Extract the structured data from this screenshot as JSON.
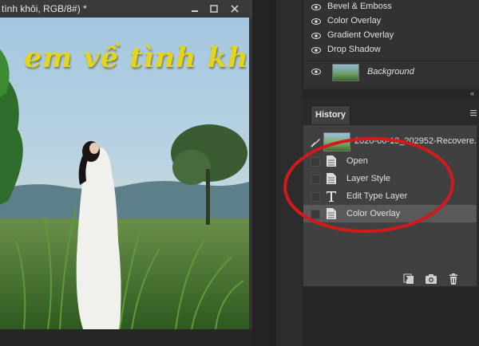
{
  "document": {
    "title": "tình khôi, RGB/8#) *",
    "canvas_text": "em về tình khôi"
  },
  "layers": {
    "effects": [
      {
        "label": "Bevel & Emboss"
      },
      {
        "label": "Color Overlay"
      },
      {
        "label": "Gradient Overlay"
      },
      {
        "label": "Drop Shadow"
      }
    ],
    "background_label": "Background"
  },
  "history": {
    "tab_label": "History",
    "collapse_label": "«",
    "snapshot_label": "2020-06-18_202952-Recovere...",
    "states": [
      {
        "label": "Open",
        "icon": "document-icon",
        "selected": false
      },
      {
        "label": "Layer Style",
        "icon": "document-icon",
        "selected": false
      },
      {
        "label": "Edit Type Layer",
        "icon": "type-tool-icon",
        "selected": false
      },
      {
        "label": "Color Overlay",
        "icon": "document-icon",
        "selected": true
      }
    ],
    "footer_icons": [
      "new-document-from-state-icon",
      "camera-snapshot-icon",
      "trash-icon"
    ]
  },
  "colors": {
    "text_fill": "#e4d51a",
    "annotation": "#d11a1a",
    "selected_row": "#595959"
  }
}
